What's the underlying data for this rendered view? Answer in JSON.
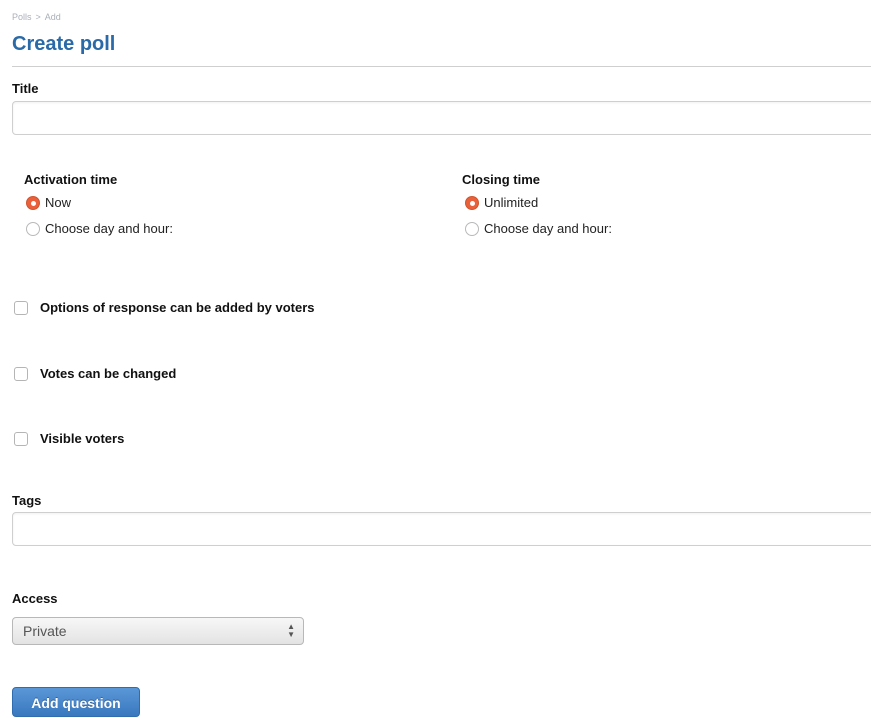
{
  "breadcrumb": {
    "items": [
      "Polls",
      "Add"
    ],
    "separator": ">"
  },
  "page": {
    "title": "Create poll"
  },
  "form": {
    "title": {
      "label": "Title",
      "value": "",
      "placeholder": ""
    },
    "activation": {
      "label": "Activation time",
      "options": [
        {
          "label": "Now",
          "checked": true
        },
        {
          "label": "Choose day and hour:",
          "checked": false
        }
      ]
    },
    "closing": {
      "label": "Closing time",
      "options": [
        {
          "label": "Unlimited",
          "checked": true
        },
        {
          "label": "Choose day and hour:",
          "checked": false
        }
      ]
    },
    "checkboxes": [
      {
        "label": "Options of response can be added by voters",
        "checked": false
      },
      {
        "label": "Votes can be changed",
        "checked": false
      },
      {
        "label": "Visible voters",
        "checked": false
      }
    ],
    "tags": {
      "label": "Tags",
      "value": "",
      "placeholder": ""
    },
    "access": {
      "label": "Access",
      "selected": "Private"
    },
    "submit_label": "Add question"
  },
  "colors": {
    "accent": "#2a6aa8",
    "radio_checked": "#e9603a",
    "button": "#3a78bf"
  }
}
